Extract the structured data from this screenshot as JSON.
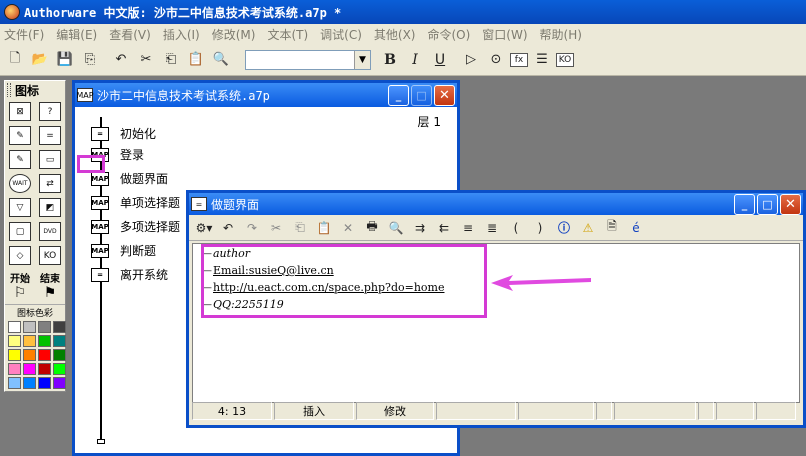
{
  "app": {
    "title": "Authorware 中文版: 沙市二中信息技术考试系统.a7p *"
  },
  "menu": [
    "文件(F)",
    "编辑(E)",
    "查看(V)",
    "插入(I)",
    "修改(M)",
    "文本(T)",
    "调试(C)",
    "其他(X)",
    "命令(O)",
    "窗口(W)",
    "帮助(H)"
  ],
  "toolbar": {
    "font_value": "",
    "bold": "B",
    "italic": "I",
    "underline": "U"
  },
  "palette": {
    "title": "图标",
    "start_label": "开始",
    "end_label": "结束",
    "color_title": "图标色彩",
    "icon_texts": [
      "⊠",
      "?",
      "✎",
      "=",
      "✎",
      "▭",
      "WAIT",
      "⇄",
      "▽",
      "◩",
      "▢",
      "DVD",
      "◇",
      "KO"
    ],
    "colors": [
      "#ffffff",
      "#c0c0c0",
      "#808080",
      "#404040",
      "#ffff80",
      "#ffc040",
      "#00c000",
      "#008080",
      "#ffff00",
      "#ff8000",
      "#ff0000",
      "#008000",
      "#ff80c0",
      "#ff00ff",
      "#c00000",
      "#00ff00",
      "#80c0ff",
      "#0080ff",
      "#0000ff",
      "#8000ff"
    ]
  },
  "flow_window": {
    "title": "沙市二中信息技术考试系统.a7p",
    "layer": "层 1",
    "items": [
      {
        "label": "初始化",
        "icon": "="
      },
      {
        "label": "登录",
        "icon": "MAP"
      },
      {
        "label": "做题界面",
        "icon": "MAP"
      },
      {
        "label": "单项选择题",
        "icon": "MAP"
      },
      {
        "label": "多项选择题",
        "icon": "MAP"
      },
      {
        "label": "判断题",
        "icon": "MAP"
      },
      {
        "label": "离开系统",
        "icon": "="
      }
    ]
  },
  "code_window": {
    "title": "做题界面",
    "lines": [
      "author",
      "Email:susieQ@live.cn",
      "http://u.eact.com.cn/space.php?do=home",
      "QQ:2255119"
    ],
    "status": [
      "4: 13",
      "插入",
      "修改",
      "",
      "",
      "",
      "",
      "",
      "",
      ""
    ]
  },
  "colors": {
    "titlebar": "#0a5be0",
    "highlight": "#d43ad4",
    "window_bg": "#ece9d8"
  }
}
